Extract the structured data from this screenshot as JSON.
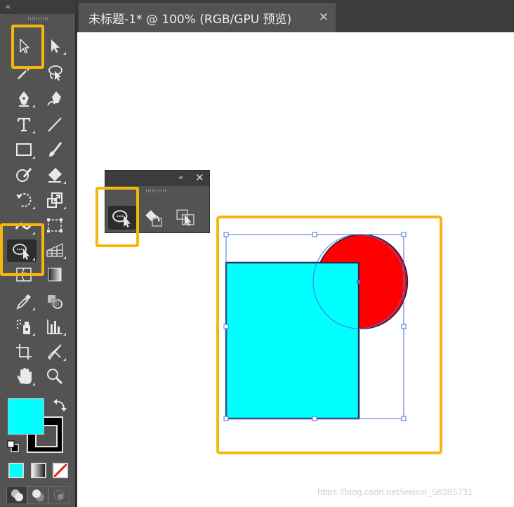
{
  "toolbar": {
    "collapse_label": "‹‹",
    "tools": [
      {
        "id": "selection-tool",
        "icon": "selection-arrow-icon"
      },
      {
        "id": "direct-selection-tool",
        "icon": "direct-selection-arrow-icon"
      },
      {
        "id": "magic-wand-tool",
        "icon": "magic-wand-icon"
      },
      {
        "id": "lasso-tool",
        "icon": "lasso-icon"
      },
      {
        "id": "pen-tool",
        "icon": "pen-icon"
      },
      {
        "id": "curvature-tool",
        "icon": "curvature-pen-icon"
      },
      {
        "id": "type-tool",
        "icon": "type-icon"
      },
      {
        "id": "line-tool",
        "icon": "line-segment-icon"
      },
      {
        "id": "rectangle-tool",
        "icon": "rectangle-icon"
      },
      {
        "id": "paintbrush-tool",
        "icon": "paintbrush-icon"
      },
      {
        "id": "shaper-tool",
        "icon": "shaper-icon"
      },
      {
        "id": "eraser-tool",
        "icon": "eraser-icon"
      },
      {
        "id": "rotate-tool",
        "icon": "rotate-icon"
      },
      {
        "id": "scale-tool",
        "icon": "scale-icon"
      },
      {
        "id": "width-tool",
        "icon": "width-icon"
      },
      {
        "id": "free-transform-tool",
        "icon": "free-transform-icon"
      },
      {
        "id": "shape-builder-tool",
        "icon": "shape-builder-icon"
      },
      {
        "id": "perspective-grid-tool",
        "icon": "perspective-grid-icon"
      },
      {
        "id": "mesh-tool",
        "icon": "mesh-icon"
      },
      {
        "id": "gradient-tool",
        "icon": "gradient-icon"
      },
      {
        "id": "eyedropper-tool",
        "icon": "eyedropper-icon"
      },
      {
        "id": "blend-tool",
        "icon": "blend-icon"
      },
      {
        "id": "symbol-sprayer-tool",
        "icon": "symbol-sprayer-icon"
      },
      {
        "id": "column-graph-tool",
        "icon": "column-graph-icon"
      },
      {
        "id": "artboard-tool",
        "icon": "artboard-icon"
      },
      {
        "id": "slice-tool",
        "icon": "slice-icon"
      },
      {
        "id": "hand-tool",
        "icon": "hand-icon"
      },
      {
        "id": "zoom-tool",
        "icon": "zoom-icon"
      }
    ],
    "fill_color": "#00FFFF",
    "stroke_color": "#000000"
  },
  "document_tab": {
    "title": "未标题-1* @ 100% (RGB/GPU 预览)",
    "close_label": "×"
  },
  "panel": {
    "collapse_label": "‹‹",
    "close_label": "✕",
    "tools": [
      "shape-builder-icon",
      "live-paint-bucket-icon",
      "live-paint-selection-icon"
    ]
  },
  "artwork": {
    "rectangle_fill": "#00FFFF",
    "circle_fill": "#FF0000",
    "highlight_color": "#F6B70C",
    "selection_color": "#4A6FD4"
  },
  "watermark": "https://blog.csdn.net/weixin_58385731"
}
